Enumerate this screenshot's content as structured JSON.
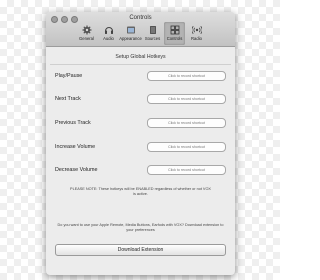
{
  "window": {
    "title": "Controls"
  },
  "toolbar": {
    "items": [
      {
        "label": "General",
        "icon": "gear-icon"
      },
      {
        "label": "Audio",
        "icon": "headphones-icon"
      },
      {
        "label": "Appearance",
        "icon": "appearance-icon"
      },
      {
        "label": "Sources",
        "icon": "sources-icon"
      },
      {
        "label": "Controls",
        "icon": "controls-grid-icon",
        "selected": true
      },
      {
        "label": "Radio",
        "icon": "radio-icon"
      }
    ]
  },
  "main": {
    "section_title": "Setup Global Hotkeys",
    "hotkeys": [
      {
        "label": "Play/Pause",
        "field_text": "Click to record shortcut"
      },
      {
        "label": "Next Track",
        "field_text": "Click to record shortcut"
      },
      {
        "label": "Previous Track",
        "field_text": "Click to record shortcut"
      },
      {
        "label": "Increase Volume",
        "field_text": "Click to record shortcut"
      },
      {
        "label": "Decrease Volume",
        "field_text": "Click to record shortcut"
      }
    ],
    "note": "PLEASE NOTE: These hotkeys will be ENABLED regardless of whether or not VOX is active.",
    "question": "Do you want to use your Apple Remote, Media Buttons, Earfods with VOX? Download extension to your preferences",
    "download_label": "Download Extension"
  }
}
